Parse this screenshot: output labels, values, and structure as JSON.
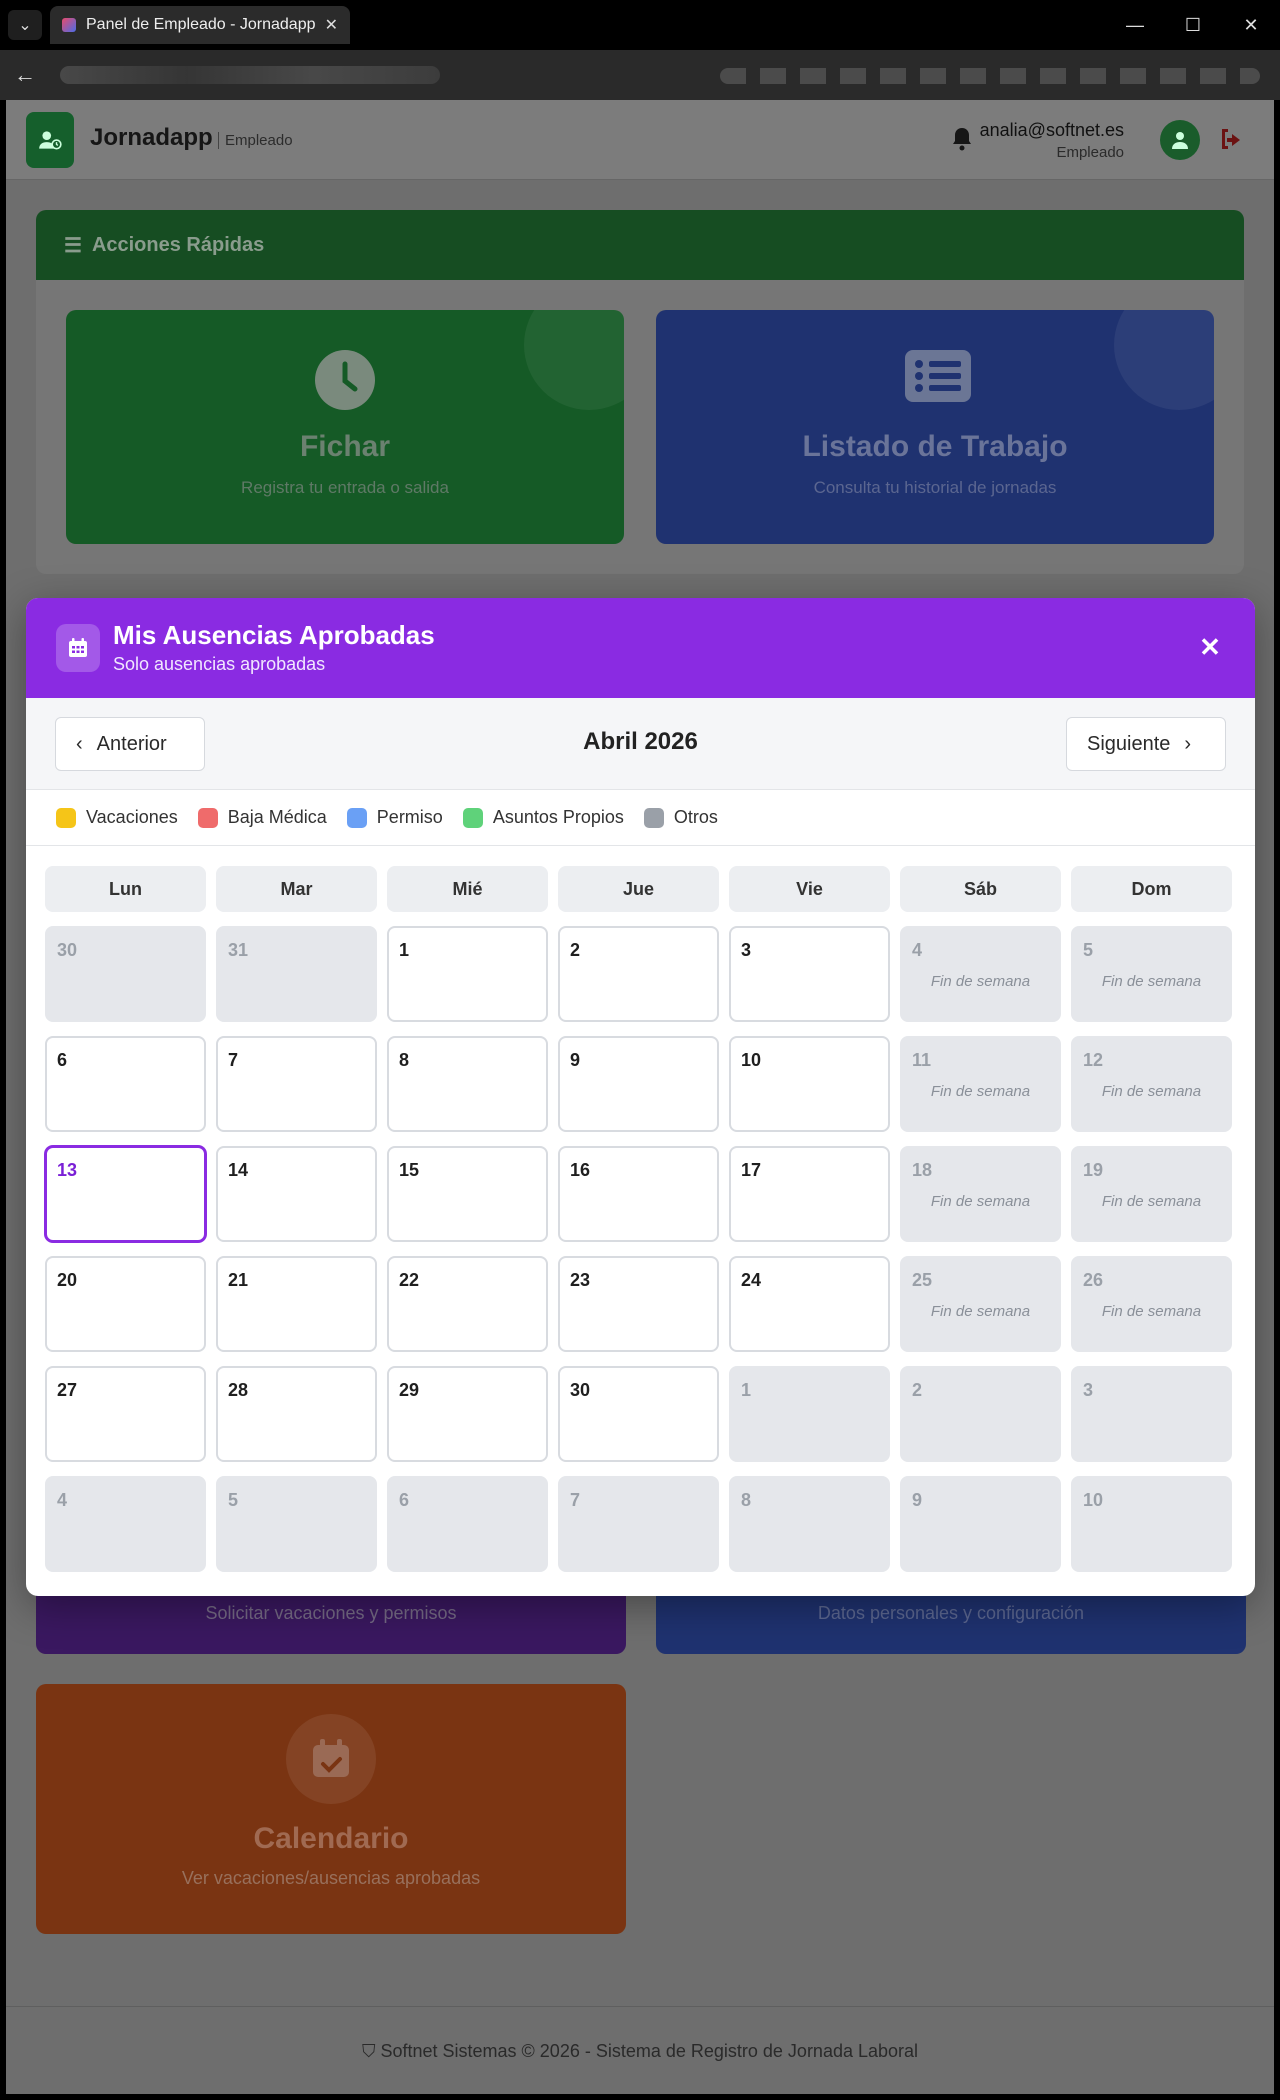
{
  "browser": {
    "tab_title": "Panel de Empleado - Jornadapp"
  },
  "app": {
    "brand": "Jornadapp",
    "role": "Empleado",
    "user_email": "analia@softnet.es",
    "user_role": "Empleado"
  },
  "quick_actions": {
    "header": "Acciones Rápidas",
    "cards": [
      {
        "title": "Fichar",
        "subtitle": "Registra tu entrada o salida",
        "icon": "clock-icon"
      },
      {
        "title": "Listado de Trabajo",
        "subtitle": "Consulta tu historial de jornadas",
        "icon": "list-icon"
      }
    ]
  },
  "background_cards": {
    "absences_sub": "Solicitar vacaciones y permisos",
    "profile_sub": "Datos personales y configuración",
    "calendar_title": "Calendario",
    "calendar_sub": "Ver vacaciones/ausencias aprobadas"
  },
  "footer": {
    "text": "Softnet Sistemas © 2026 - Sistema de Registro de Jornada Laboral"
  },
  "modal": {
    "title": "Mis Ausencias Aprobadas",
    "subtitle": "Solo ausencias aprobadas",
    "prev_label": "Anterior",
    "next_label": "Siguiente",
    "month_label": "Abril 2026",
    "legend": [
      {
        "label": "Vacaciones",
        "color": "#f5c518"
      },
      {
        "label": "Baja Médica",
        "color": "#ef6b6b"
      },
      {
        "label": "Permiso",
        "color": "#6aa0f5"
      },
      {
        "label": "Asuntos Propios",
        "color": "#5fd27a"
      },
      {
        "label": "Otros",
        "color": "#9aa0a8"
      }
    ],
    "weekdays": [
      "Lun",
      "Mar",
      "Mié",
      "Jue",
      "Vie",
      "Sáb",
      "Dom"
    ],
    "weekend_label": "Fin de semana",
    "weeks": [
      [
        "30",
        "31",
        "1",
        "2",
        "3",
        "4",
        "5"
      ],
      [
        "6",
        "7",
        "8",
        "9",
        "10",
        "11",
        "12"
      ],
      [
        "13",
        "14",
        "15",
        "16",
        "17",
        "18",
        "19"
      ],
      [
        "20",
        "21",
        "22",
        "23",
        "24",
        "25",
        "26"
      ],
      [
        "27",
        "28",
        "29",
        "30",
        "1",
        "2",
        "3"
      ],
      [
        "4",
        "5",
        "6",
        "7",
        "8",
        "9",
        "10"
      ]
    ],
    "today": "13",
    "accent_color": "#8a2be2"
  }
}
